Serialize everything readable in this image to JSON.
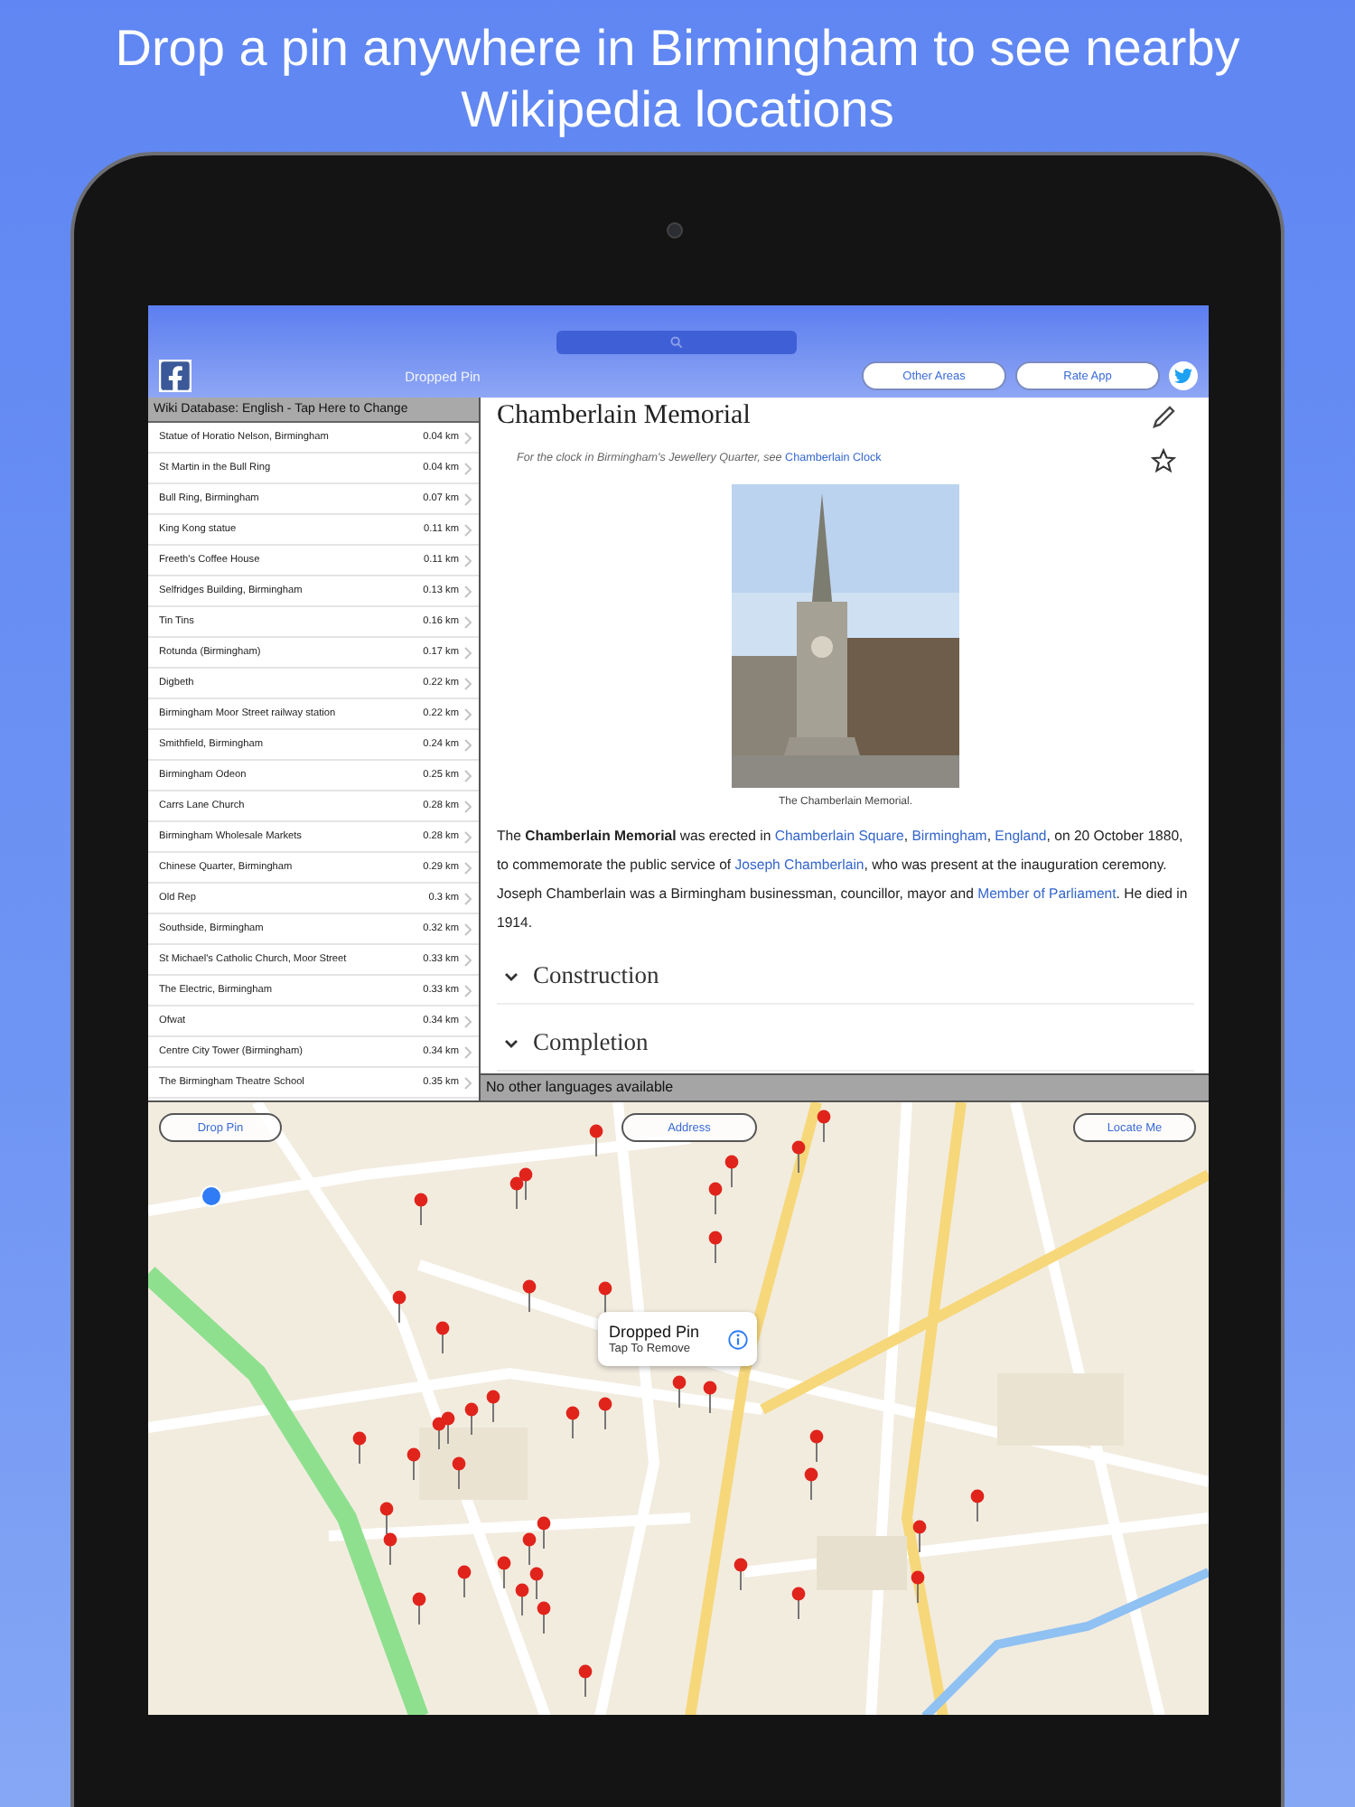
{
  "headline": "Drop a pin anywhere in Birmingham to see nearby Wikipedia locations",
  "toolbar": {
    "title": "Dropped Pin",
    "buttons": [
      "Other Areas",
      "Rate App"
    ]
  },
  "list": {
    "header": "Wiki Database: English - Tap Here to Change",
    "rows": [
      {
        "name": "Statue of Horatio Nelson, Birmingham",
        "distance": "0.04 km"
      },
      {
        "name": "St Martin in the Bull Ring",
        "distance": "0.04 km"
      },
      {
        "name": "Bull Ring, Birmingham",
        "distance": "0.07 km"
      },
      {
        "name": "King Kong statue",
        "distance": "0.11 km"
      },
      {
        "name": "Freeth's Coffee House",
        "distance": "0.11 km"
      },
      {
        "name": "Selfridges Building, Birmingham",
        "distance": "0.13 km"
      },
      {
        "name": "Tin Tins",
        "distance": "0.16 km"
      },
      {
        "name": "Rotunda (Birmingham)",
        "distance": "0.17 km"
      },
      {
        "name": "Digbeth",
        "distance": "0.22 km"
      },
      {
        "name": "Birmingham Moor Street railway station",
        "distance": "0.22 km"
      },
      {
        "name": "Smithfield, Birmingham",
        "distance": "0.24 km"
      },
      {
        "name": "Birmingham Odeon",
        "distance": "0.25 km"
      },
      {
        "name": "Carrs Lane Church",
        "distance": "0.28 km"
      },
      {
        "name": "Birmingham Wholesale Markets",
        "distance": "0.28 km"
      },
      {
        "name": "Chinese Quarter, Birmingham",
        "distance": "0.29 km"
      },
      {
        "name": "Old Rep",
        "distance": "0.3 km"
      },
      {
        "name": "Southside, Birmingham",
        "distance": "0.32 km"
      },
      {
        "name": "St Michael's Catholic Church, Moor Street",
        "distance": "0.33 km"
      },
      {
        "name": "The Electric, Birmingham",
        "distance": "0.33 km"
      },
      {
        "name": "Ofwat",
        "distance": "0.34 km"
      },
      {
        "name": "Centre City Tower (Birmingham)",
        "distance": "0.34 km"
      },
      {
        "name": "The Birmingham Theatre School",
        "distance": "0.35 km"
      }
    ]
  },
  "article": {
    "title": "Chamberlain Memorial",
    "hatnote": "For the clock in Birmingham's Jewellery Quarter, see ",
    "hatnote_link": "Chamberlain Clock",
    "image": {
      "kind": "picture",
      "caption": "The Chamberlain Memorial."
    },
    "paragraph": [
      {
        "kind": "plain",
        "text": "The "
      },
      {
        "kind": "bold",
        "text": "Chamberlain Memorial"
      },
      {
        "kind": "plain",
        "text": " was erected in "
      },
      {
        "kind": "link",
        "text": "Chamberlain Square"
      },
      {
        "kind": "plain",
        "text": ", "
      },
      {
        "kind": "link",
        "text": "Birmingham"
      },
      {
        "kind": "plain",
        "text": ", "
      },
      {
        "kind": "link",
        "text": "England"
      },
      {
        "kind": "plain",
        "text": ", on 20 October 1880, to commemorate the public service of "
      },
      {
        "kind": "link",
        "text": "Joseph Chamberlain"
      },
      {
        "kind": "plain",
        "text": ", who was present at the inauguration ceremony. Joseph Chamberlain was a Birmingham businessman, councillor, mayor and "
      },
      {
        "kind": "link",
        "text": "Member of Parliament"
      },
      {
        "kind": "plain",
        "text": ". He died in 1914."
      }
    ],
    "sections": [
      "Construction",
      "Completion"
    ]
  },
  "language_bar": "No other languages available",
  "map": {
    "buttons": [
      "Drop Pin",
      "Address",
      "Locate Me"
    ],
    "callout": {
      "title": "Dropped Pin",
      "subtitle": "Tap To Remove"
    }
  }
}
